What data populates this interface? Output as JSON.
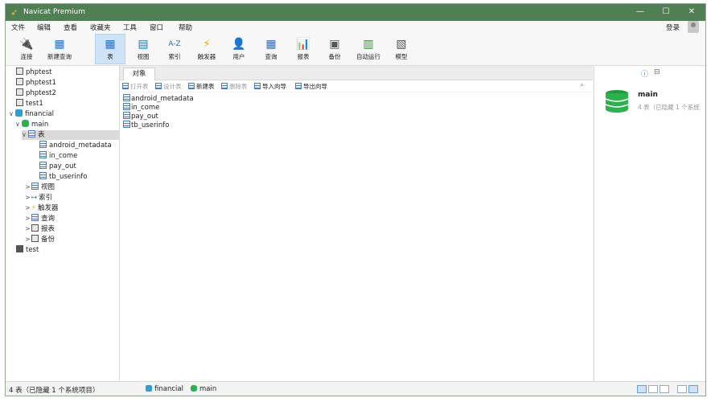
{
  "window": {
    "title": "Navicat Premium",
    "min_icon": "—",
    "max_icon": "☐",
    "close_icon": "✕"
  },
  "menu": [
    "文件",
    "编辑",
    "查看",
    "收藏夹",
    "工具",
    "窗口",
    "帮助"
  ],
  "login_label": "登录",
  "toolbar": [
    {
      "label": "连接",
      "icon": "connect-icon",
      "glyph": "🔌"
    },
    {
      "label": "新建查询",
      "icon": "new-query-icon",
      "glyph": "▦"
    },
    {
      "label": "表",
      "icon": "table-icon",
      "glyph": "▦"
    },
    {
      "label": "视图",
      "icon": "view-icon",
      "glyph": "▤"
    },
    {
      "label": "索引",
      "icon": "index-icon",
      "glyph": "A-Z"
    },
    {
      "label": "触发器",
      "icon": "trigger-icon",
      "glyph": "⚡"
    },
    {
      "label": "用户",
      "icon": "user-icon",
      "glyph": "👤"
    },
    {
      "label": "查询",
      "icon": "query-icon",
      "glyph": "▦"
    },
    {
      "label": "报表",
      "icon": "report-icon",
      "glyph": "📊"
    },
    {
      "label": "备份",
      "icon": "backup-icon",
      "glyph": "▣"
    },
    {
      "label": "自动运行",
      "icon": "automation-icon",
      "glyph": "▥"
    },
    {
      "label": "模型",
      "icon": "model-icon",
      "glyph": "▧"
    }
  ],
  "tree": [
    {
      "label": "phptest"
    },
    {
      "label": "phptest1"
    },
    {
      "label": "phptest2"
    },
    {
      "label": "test1"
    },
    {
      "label": "financial",
      "caret": "∨"
    },
    {
      "label": "main",
      "caret": "∨"
    },
    {
      "label": "表",
      "caret": "∨"
    },
    {
      "label": "android_metadata"
    },
    {
      "label": "in_come"
    },
    {
      "label": "pay_out"
    },
    {
      "label": "tb_userinfo"
    },
    {
      "label": "视图",
      "caret": ">"
    },
    {
      "label": "索引",
      "caret": ">",
      "glyph": "↦"
    },
    {
      "label": "触发器",
      "caret": ">",
      "glyph": "⚡"
    },
    {
      "label": "查询",
      "caret": ">"
    },
    {
      "label": "报表",
      "caret": ">"
    },
    {
      "label": "备份",
      "caret": ">"
    },
    {
      "label": "test"
    }
  ],
  "tab_label": "对象",
  "object_toolbar": [
    {
      "label": "打开表",
      "enabled": false
    },
    {
      "label": "设计表",
      "enabled": false
    },
    {
      "label": "新建表",
      "enabled": true
    },
    {
      "label": "删除表",
      "enabled": false
    },
    {
      "label": "导入向导",
      "enabled": true
    },
    {
      "label": "导出向导",
      "enabled": true
    }
  ],
  "search_icon": "⌕",
  "objects": [
    "android_metadata",
    "in_come",
    "pay_out",
    "tb_userinfo"
  ],
  "info": {
    "name": "main",
    "sub": "4 表（已隐藏 1 个系统",
    "info_glyph": "ⓘ",
    "ddl_glyph": "⊟"
  },
  "status": {
    "left": "4 表（已隐藏 1 个系统项目）",
    "connection": "financial",
    "database": "main"
  },
  "colors": {
    "titlebar": "#4f7f53",
    "db_green": "#2bb24c",
    "selection": "#cfe3f6"
  }
}
